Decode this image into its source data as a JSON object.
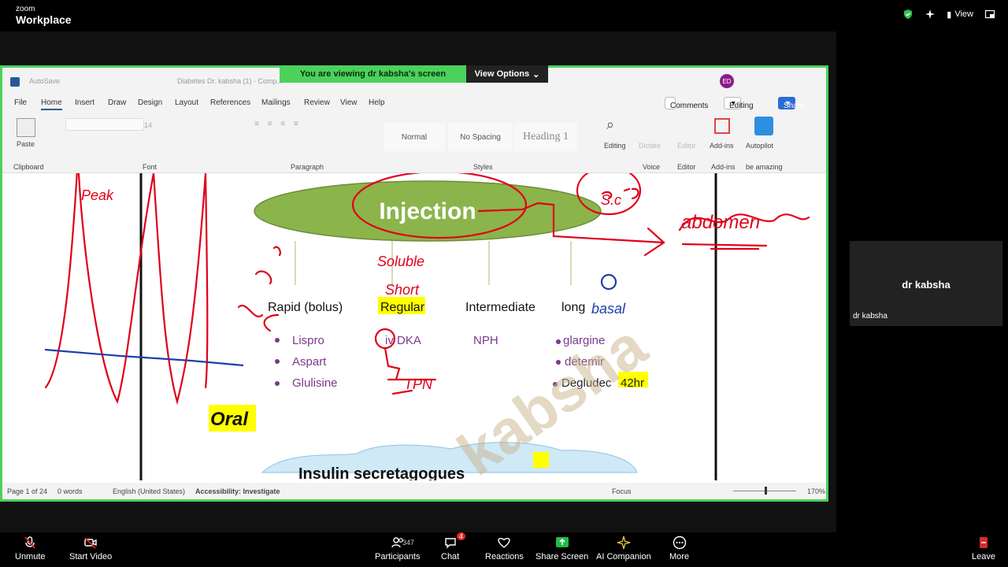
{
  "zoom": {
    "brand_small": "zoom",
    "brand_big": "Workplace",
    "view_label": "View",
    "banner_text": "You are viewing dr kabsha's screen",
    "view_options": "View Options",
    "participant_name": "dr kabsha",
    "participant_tag": "dr kabsha",
    "participants_count": "347",
    "chat_badge": "4",
    "toolbar": {
      "unmute": "Unmute",
      "start_video": "Start Video",
      "participants": "Participants",
      "chat": "Chat",
      "reactions": "Reactions",
      "share_screen": "Share Screen",
      "ai_companion": "AI Companion",
      "more": "More",
      "leave": "Leave"
    }
  },
  "word": {
    "autosave": "AutoSave",
    "doc_title": "Diabetes Dr. kabsha (1) - Comp...",
    "avatar": "ED",
    "menu": [
      "File",
      "Home",
      "Insert",
      "Draw",
      "Design",
      "Layout",
      "References",
      "Mailings",
      "Review",
      "View",
      "Help"
    ],
    "comments": "Comments",
    "editing_btn": "Editing",
    "share": "Share",
    "paste": "Paste",
    "font_size": "14",
    "styles": [
      "Normal",
      "No Spacing",
      "Heading 1"
    ],
    "editing": "Editing",
    "dictate": "Dictate",
    "editor": "Editor",
    "addins": "Add-ins",
    "autopilot": "Autopilot",
    "groups": [
      "Clipboard",
      "Font",
      "Paragraph",
      "Styles",
      "Voice",
      "Editor",
      "Add-ins",
      "be amazing"
    ],
    "status": {
      "page": "Page 1 of 24",
      "words": "0 words",
      "lang": "English (United States)",
      "access": "Accessibility: Investigate",
      "focus": "Focus",
      "zoom": "170%"
    }
  },
  "slide": {
    "injection": "Injection",
    "categories": [
      "Rapid (bolus)",
      "Regular",
      "Intermediate",
      "long"
    ],
    "rapid": [
      "Lispro",
      "Aspart",
      "Glulisine"
    ],
    "regular": [
      "iv DKA"
    ],
    "intermediate": [
      "NPH"
    ],
    "long": [
      "glargine",
      "detemir",
      "Degludec"
    ],
    "degludec_hr": "42hr",
    "oral": "Oral",
    "bottom": "Insulin secretagogues",
    "watermark": "kabsha"
  },
  "annotations": {
    "peak": "Peak",
    "sc": "S.c",
    "abdomen": "abdomen",
    "soluble": "Soluble",
    "short": "Short",
    "basal": "basal",
    "tpn": "TPN"
  }
}
